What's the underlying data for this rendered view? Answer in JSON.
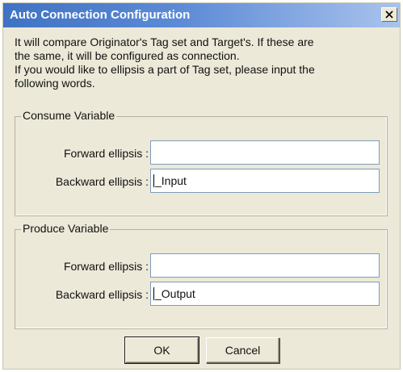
{
  "window": {
    "title": "Auto Connection Configuration",
    "close_symbol": "×"
  },
  "description": {
    "lines": [
      "It will compare Originator's Tag set and Target's. If these are",
      "the same, it will be configured as connection.",
      "If you would like to ellipsis a part of Tag set, please input the",
      "following words."
    ]
  },
  "consume": {
    "legend": "Consume Variable",
    "forward_label": "Forward ellipsis :",
    "forward_value": "",
    "backward_label": "Backward ellipsis :",
    "backward_value": "_Input"
  },
  "produce": {
    "legend": "Produce Variable",
    "forward_label": "Forward ellipsis :",
    "forward_value": "",
    "backward_label": "Backward ellipsis :",
    "backward_value": "_Output"
  },
  "buttons": {
    "ok": "OK",
    "cancel": "Cancel"
  },
  "colors": {
    "title_bar_start": "#3f73c3",
    "title_bar_end": "#a9c3ec",
    "dialog_face": "#ece9d8"
  }
}
